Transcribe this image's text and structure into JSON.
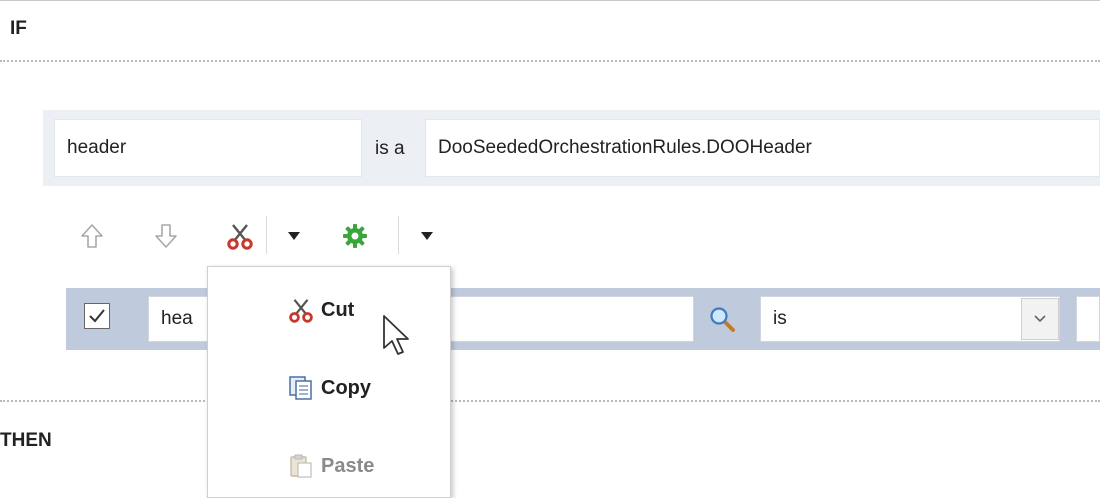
{
  "sections": {
    "if_label": "IF",
    "then_label": "THEN"
  },
  "fact": {
    "variable": "header",
    "is_a_label": "is a",
    "type": "DooSeededOrchestrationRules.DOOHeader"
  },
  "toolbar": {
    "icons": [
      "arrow-up-icon",
      "arrow-down-icon",
      "scissors-icon",
      "dropdown-caret",
      "gear-icon",
      "dropdown-caret"
    ]
  },
  "condition": {
    "checked": true,
    "field_value": "hea",
    "operator": "is"
  },
  "context_menu": {
    "items": [
      {
        "label": "Cut",
        "icon": "scissors-icon",
        "enabled": true
      },
      {
        "label": "Copy",
        "icon": "copy-icon",
        "enabled": true
      },
      {
        "label": "Paste",
        "icon": "paste-icon",
        "enabled": false
      }
    ]
  },
  "colors": {
    "fact_bar": "#eceff3",
    "condition_bar": "#bfcbdc",
    "scissors": "#c8372d",
    "gear": "#3aa63a"
  }
}
